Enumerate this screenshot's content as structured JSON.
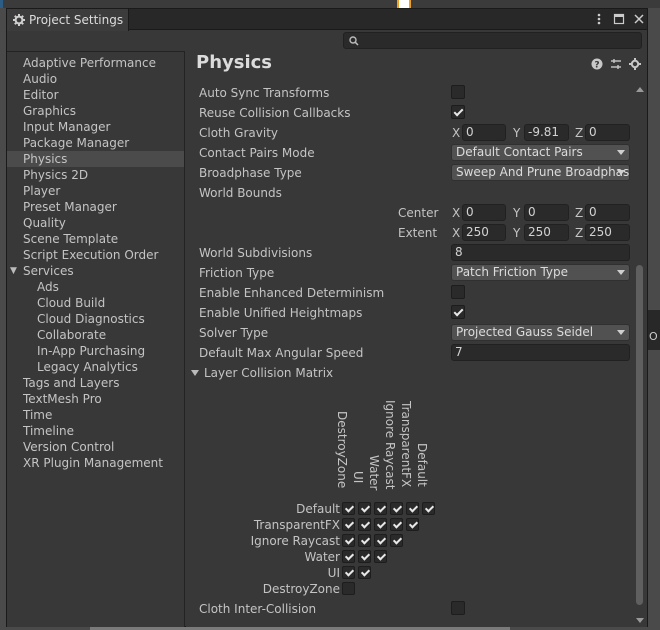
{
  "window": {
    "title": "Project Settings"
  },
  "background": {
    "right_edge_text": "O"
  },
  "search": {
    "placeholder": ""
  },
  "sidebar": {
    "items": [
      {
        "label": "Adaptive Performance"
      },
      {
        "label": "Audio"
      },
      {
        "label": "Editor"
      },
      {
        "label": "Graphics"
      },
      {
        "label": "Input Manager"
      },
      {
        "label": "Package Manager"
      },
      {
        "label": "Physics",
        "selected": true
      },
      {
        "label": "Physics 2D"
      },
      {
        "label": "Player"
      },
      {
        "label": "Preset Manager"
      },
      {
        "label": "Quality"
      },
      {
        "label": "Scene Template"
      },
      {
        "label": "Script Execution Order"
      },
      {
        "label": "Services",
        "expanded": true
      },
      {
        "label": "Ads",
        "child": true
      },
      {
        "label": "Cloud Build",
        "child": true
      },
      {
        "label": "Cloud Diagnostics",
        "child": true
      },
      {
        "label": "Collaborate",
        "child": true
      },
      {
        "label": "In-App Purchasing",
        "child": true
      },
      {
        "label": "Legacy Analytics",
        "child": true
      },
      {
        "label": "Tags and Layers"
      },
      {
        "label": "TextMesh Pro"
      },
      {
        "label": "Time"
      },
      {
        "label": "Timeline"
      },
      {
        "label": "Version Control"
      },
      {
        "label": "XR Plugin Management"
      }
    ]
  },
  "main": {
    "title": "Physics",
    "auto_sync_transforms": {
      "label": "Auto Sync Transforms",
      "checked": false
    },
    "reuse_collision_callbacks": {
      "label": "Reuse Collision Callbacks",
      "checked": true
    },
    "cloth_gravity": {
      "label": "Cloth Gravity",
      "x_label": "X",
      "x": "0",
      "y_label": "Y",
      "y": "-9.81",
      "z_label": "Z",
      "z": "0"
    },
    "contact_pairs_mode": {
      "label": "Contact Pairs Mode",
      "value": "Default Contact Pairs"
    },
    "broadphase_type": {
      "label": "Broadphase Type",
      "value": "Sweep And Prune Broadphase"
    },
    "world_bounds": {
      "label": "World Bounds",
      "center_label": "Center",
      "center": {
        "x": "0",
        "y": "0",
        "z": "0"
      },
      "extent_label": "Extent",
      "extent": {
        "x": "250",
        "y": "250",
        "z": "250"
      },
      "x_label": "X",
      "y_label": "Y",
      "z_label": "Z"
    },
    "world_subdivisions": {
      "label": "World Subdivisions",
      "value": "8"
    },
    "friction_type": {
      "label": "Friction Type",
      "value": "Patch Friction Type"
    },
    "enhanced_determinism": {
      "label": "Enable Enhanced Determinism",
      "checked": false
    },
    "unified_heightmaps": {
      "label": "Enable Unified Heightmaps",
      "checked": true
    },
    "solver_type": {
      "label": "Solver Type",
      "value": "Projected Gauss Seidel"
    },
    "max_angular_speed": {
      "label": "Default Max Angular Speed",
      "value": "7"
    },
    "layer_collision_matrix": {
      "label": "Layer Collision Matrix",
      "rows": [
        "Default",
        "TransparentFX",
        "Ignore Raycast",
        "Water",
        "UI",
        "DestroyZone"
      ],
      "columns": [
        "DestroyZone",
        "UI",
        "Water",
        "Ignore Raycast",
        "TransparentFX",
        "Default"
      ],
      "checked": [
        [
          true,
          true,
          true,
          true,
          true,
          true
        ],
        [
          true,
          true,
          true,
          true,
          true
        ],
        [
          true,
          true,
          true,
          true
        ],
        [
          true,
          true,
          true
        ],
        [
          true,
          true
        ],
        [
          false
        ]
      ]
    },
    "cloth_inter_collision": {
      "label": "Cloth Inter-Collision",
      "checked": false
    }
  }
}
